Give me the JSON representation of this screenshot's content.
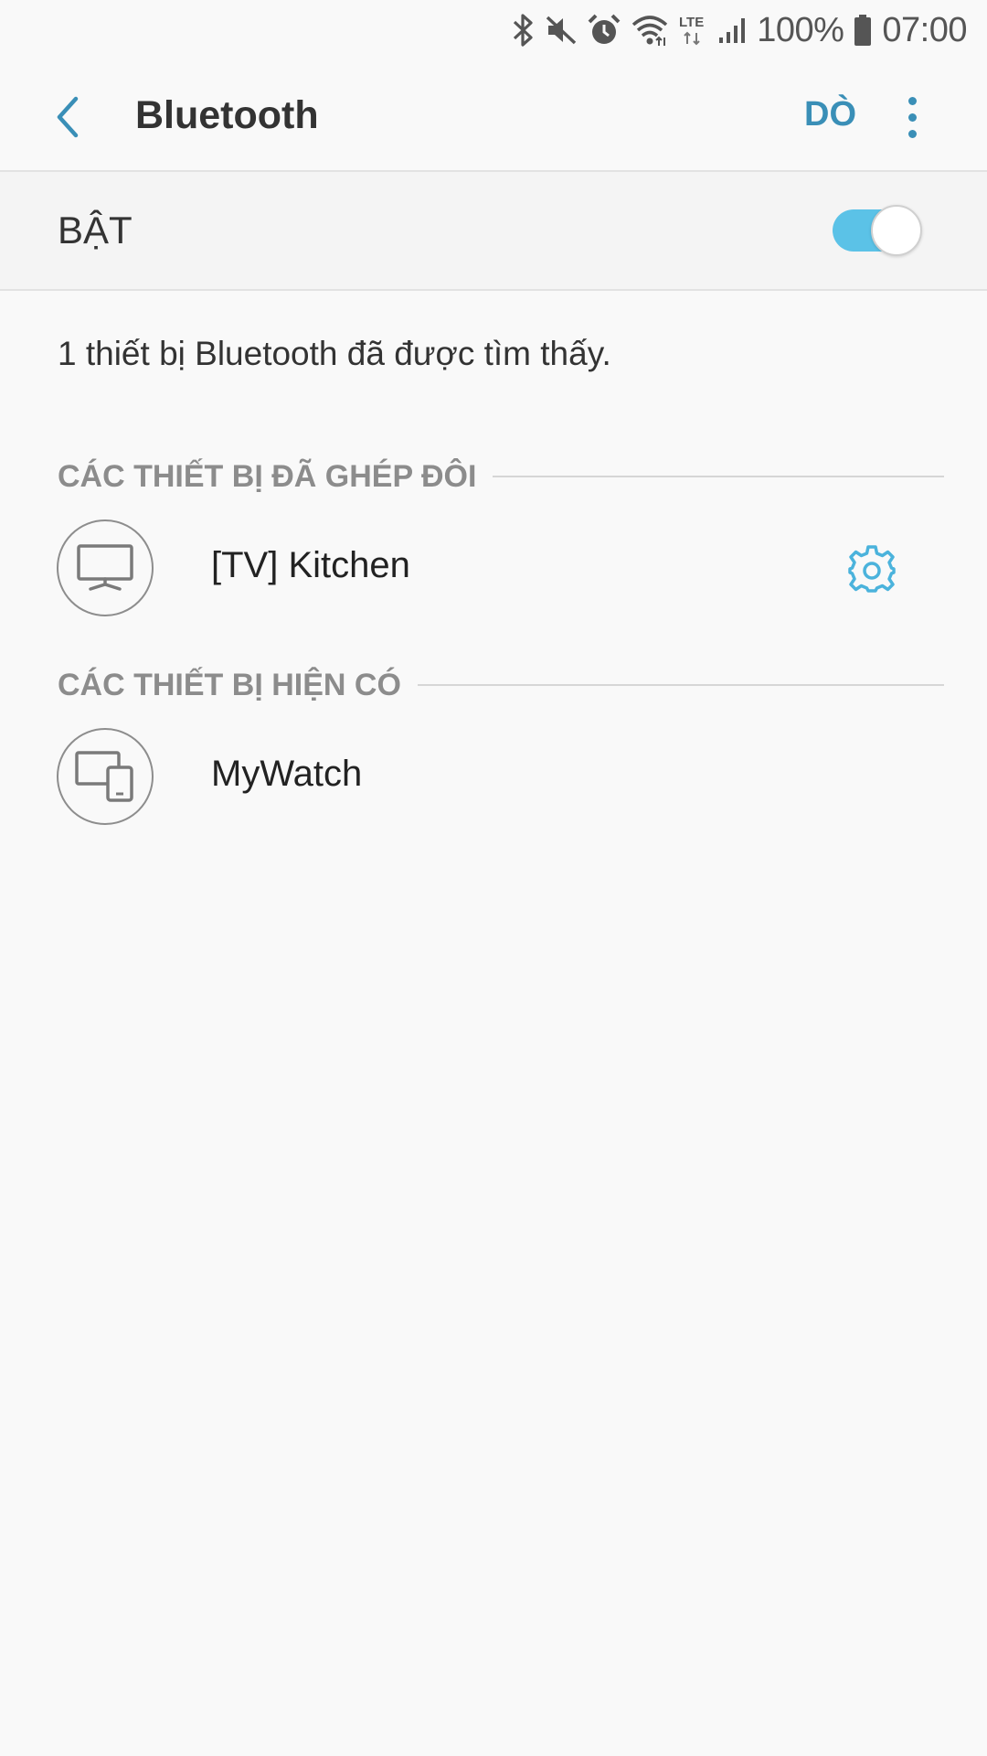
{
  "status_bar": {
    "battery": "100%",
    "time": "07:00",
    "network": "LTE",
    "icons": [
      "bluetooth-icon",
      "mute-icon",
      "alarm-icon",
      "wifi-icon",
      "lte-icon",
      "signal-icon",
      "battery-icon"
    ]
  },
  "app_bar": {
    "title": "Bluetooth",
    "scan_label": "DÒ"
  },
  "master_switch": {
    "label": "BẬT",
    "on": true,
    "track_color": "#5bc2e7"
  },
  "found_text": "1 thiết bị Bluetooth đã được tìm thấy.",
  "paired_section": {
    "header": "CÁC THIẾT BỊ ĐÃ GHÉP ĐÔI",
    "devices": [
      {
        "name": "[TV] Kitchen",
        "icon": "tv-icon",
        "has_settings": true
      }
    ]
  },
  "available_section": {
    "header": "CÁC THIẾT BỊ HIỆN CÓ",
    "devices": [
      {
        "name": "MyWatch",
        "icon": "devices-icon"
      }
    ]
  },
  "colors": {
    "accent": "#3a8fb7",
    "toggle_on": "#5bc2e7",
    "section_header": "#8c8c8c",
    "background": "#f9f9f9"
  }
}
